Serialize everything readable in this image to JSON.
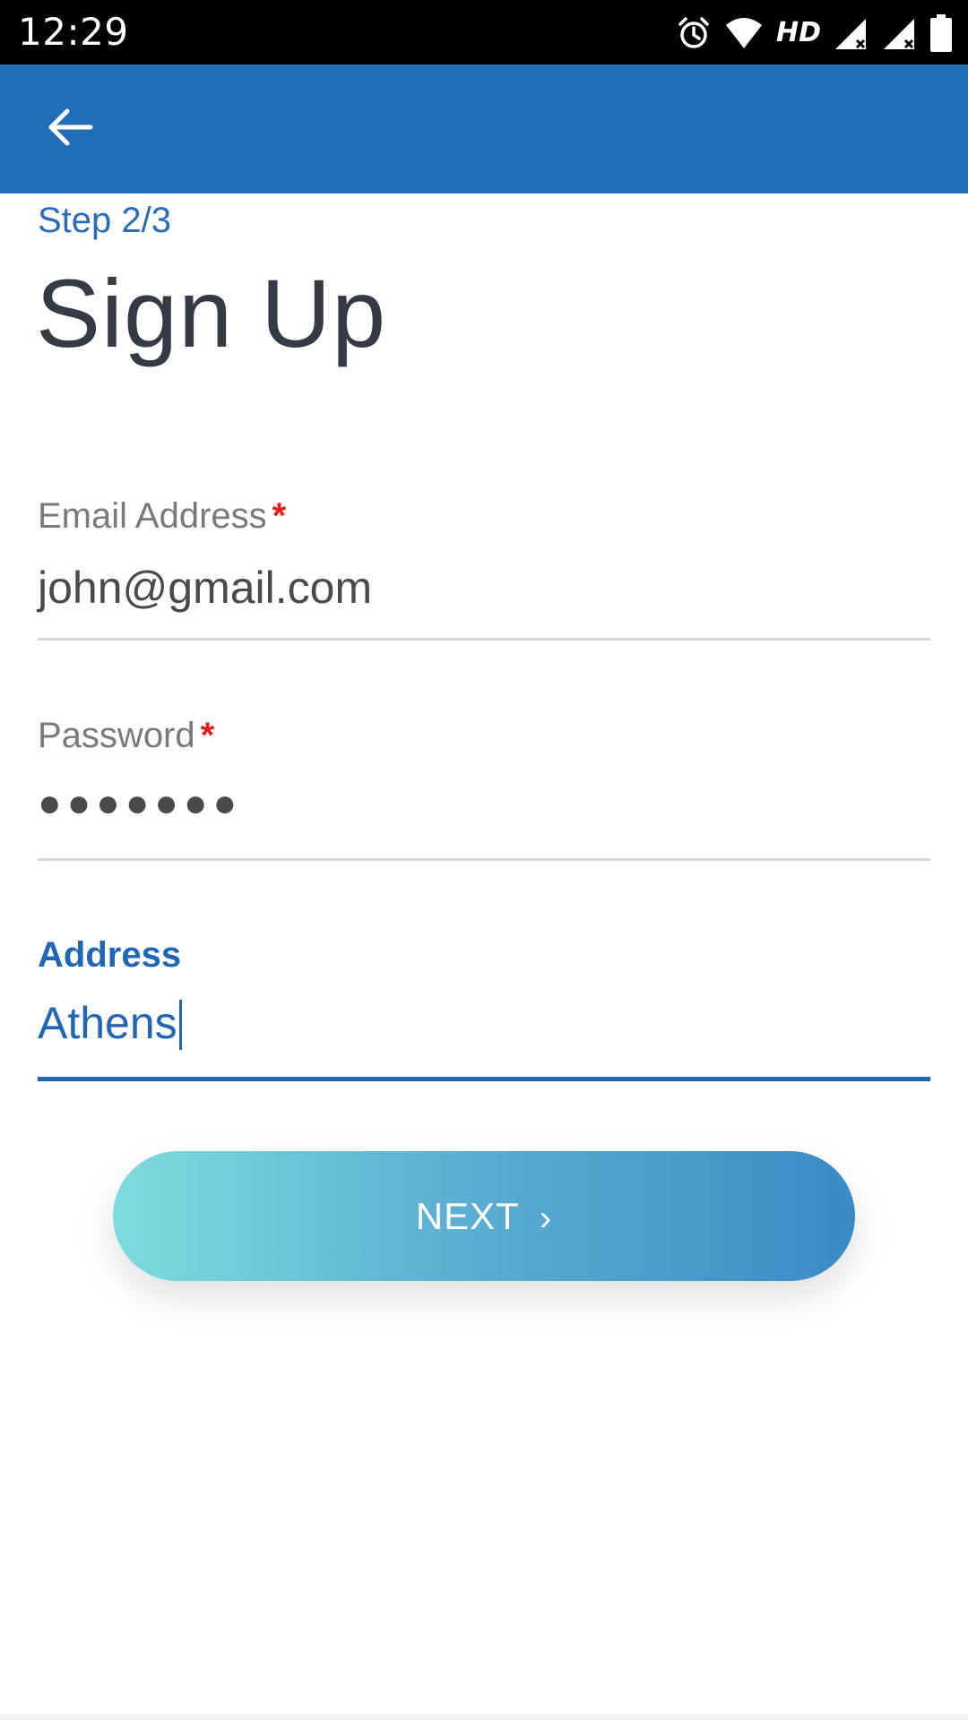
{
  "status_bar": {
    "time": "12:29",
    "hd_label": "HD",
    "icons": [
      "alarm-icon",
      "wifi-icon",
      "hd-icon",
      "signal-icon",
      "signal-icon",
      "battery-icon"
    ]
  },
  "app_bar": {
    "color": "#216dba",
    "back_icon": "arrow-left-icon"
  },
  "step_label": "Step 2/3",
  "title": "Sign Up",
  "form": {
    "email": {
      "label": "Email Address",
      "required_mark": "*",
      "value": "john@gmail.com"
    },
    "password": {
      "label": "Password",
      "required_mark": "*",
      "value": "●●●●●●●"
    },
    "address": {
      "label": "Address",
      "value": "Athens",
      "focused": true
    }
  },
  "next_button": {
    "label": "NEXT",
    "chevron": "›"
  },
  "colors": {
    "primary": "#216dba",
    "required": "#e31b1b",
    "button_gradient_start": "#7ddcdd",
    "button_gradient_end": "#3a8bc4"
  }
}
